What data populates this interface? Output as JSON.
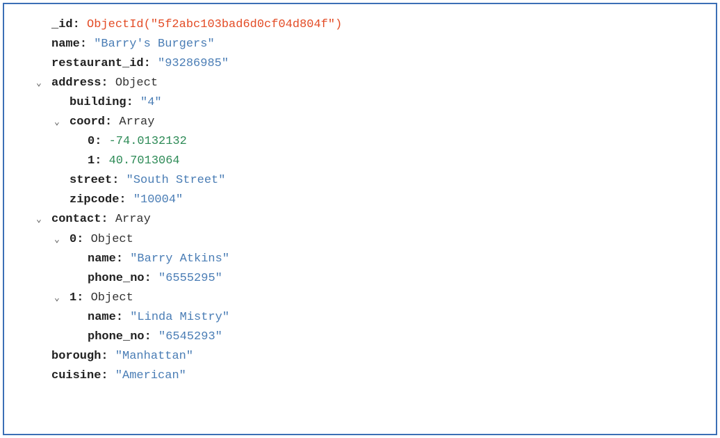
{
  "doc": {
    "id_key": "_id",
    "id_value": "ObjectId(\"5f2abc103bad6d0cf04d804f\")",
    "name_key": "name",
    "name_value": "\"Barry's Burgers\"",
    "restaurant_id_key": "restaurant_id",
    "restaurant_id_value": "\"93286985\"",
    "address_key": "address",
    "address_type": "Object",
    "address": {
      "building_key": "building",
      "building_value": "\"4\"",
      "coord_key": "coord",
      "coord_type": "Array",
      "coord": {
        "idx0_key": "0",
        "idx0_value": "-74.0132132",
        "idx1_key": "1",
        "idx1_value": "40.7013064"
      },
      "street_key": "street",
      "street_value": "\"South Street\"",
      "zipcode_key": "zipcode",
      "zipcode_value": "\"10004\""
    },
    "contact_key": "contact",
    "contact_type": "Array",
    "contact": {
      "idx0_key": "0",
      "idx0_type": "Object",
      "idx0": {
        "name_key": "name",
        "name_value": "\"Barry Atkins\"",
        "phone_key": "phone_no",
        "phone_value": "\"6555295\""
      },
      "idx1_key": "1",
      "idx1_type": "Object",
      "idx1": {
        "name_key": "name",
        "name_value": "\"Linda Mistry\"",
        "phone_key": "phone_no",
        "phone_value": "\"6545293\""
      }
    },
    "borough_key": "borough",
    "borough_value": "\"Manhattan\"",
    "cuisine_key": "cuisine",
    "cuisine_value": "\"American\""
  },
  "ui": {
    "chevron": "⌄"
  }
}
